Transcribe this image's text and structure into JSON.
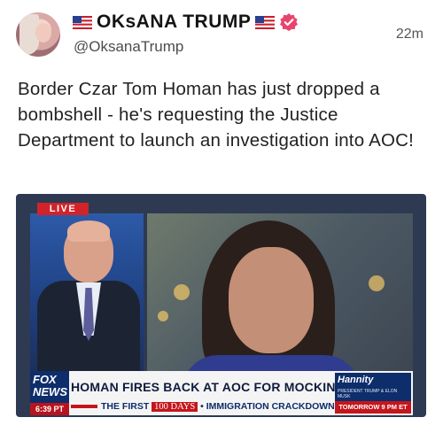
{
  "post": {
    "author_name": "OKsANA TRUMP",
    "handle": "@OksanaTrump",
    "time": "22m",
    "text": "Border Czar Tom Homan has just dropped a bombshell - he's requesting the Justice Department to launch an investigation into AOC!"
  },
  "media": {
    "live_label": "LIVE",
    "network_line1": "FOX",
    "network_line2": "NEWS",
    "clock": "6:39 PT",
    "headline": "HOMAN FIRES BACK AT AOC FOR MOCKING WARNING",
    "ticker_prefix": "THE FIRST",
    "ticker_box": "100 DAYS",
    "ticker_sep": "•",
    "ticker_suffix": "IMMIGRATION CRACKDOWN",
    "promo_brand": "Hannity",
    "promo_small": "PRESIDENT TRUMP & ELON MUSK",
    "promo_time": "TOMORROW 9 PM ET"
  },
  "colors": {
    "verified": "#e8446d",
    "live_red": "#d2232a",
    "fox_blue": "#0d2d6b"
  },
  "icons": {
    "flag": "us-flag-icon",
    "verified": "verified-badge-icon"
  }
}
